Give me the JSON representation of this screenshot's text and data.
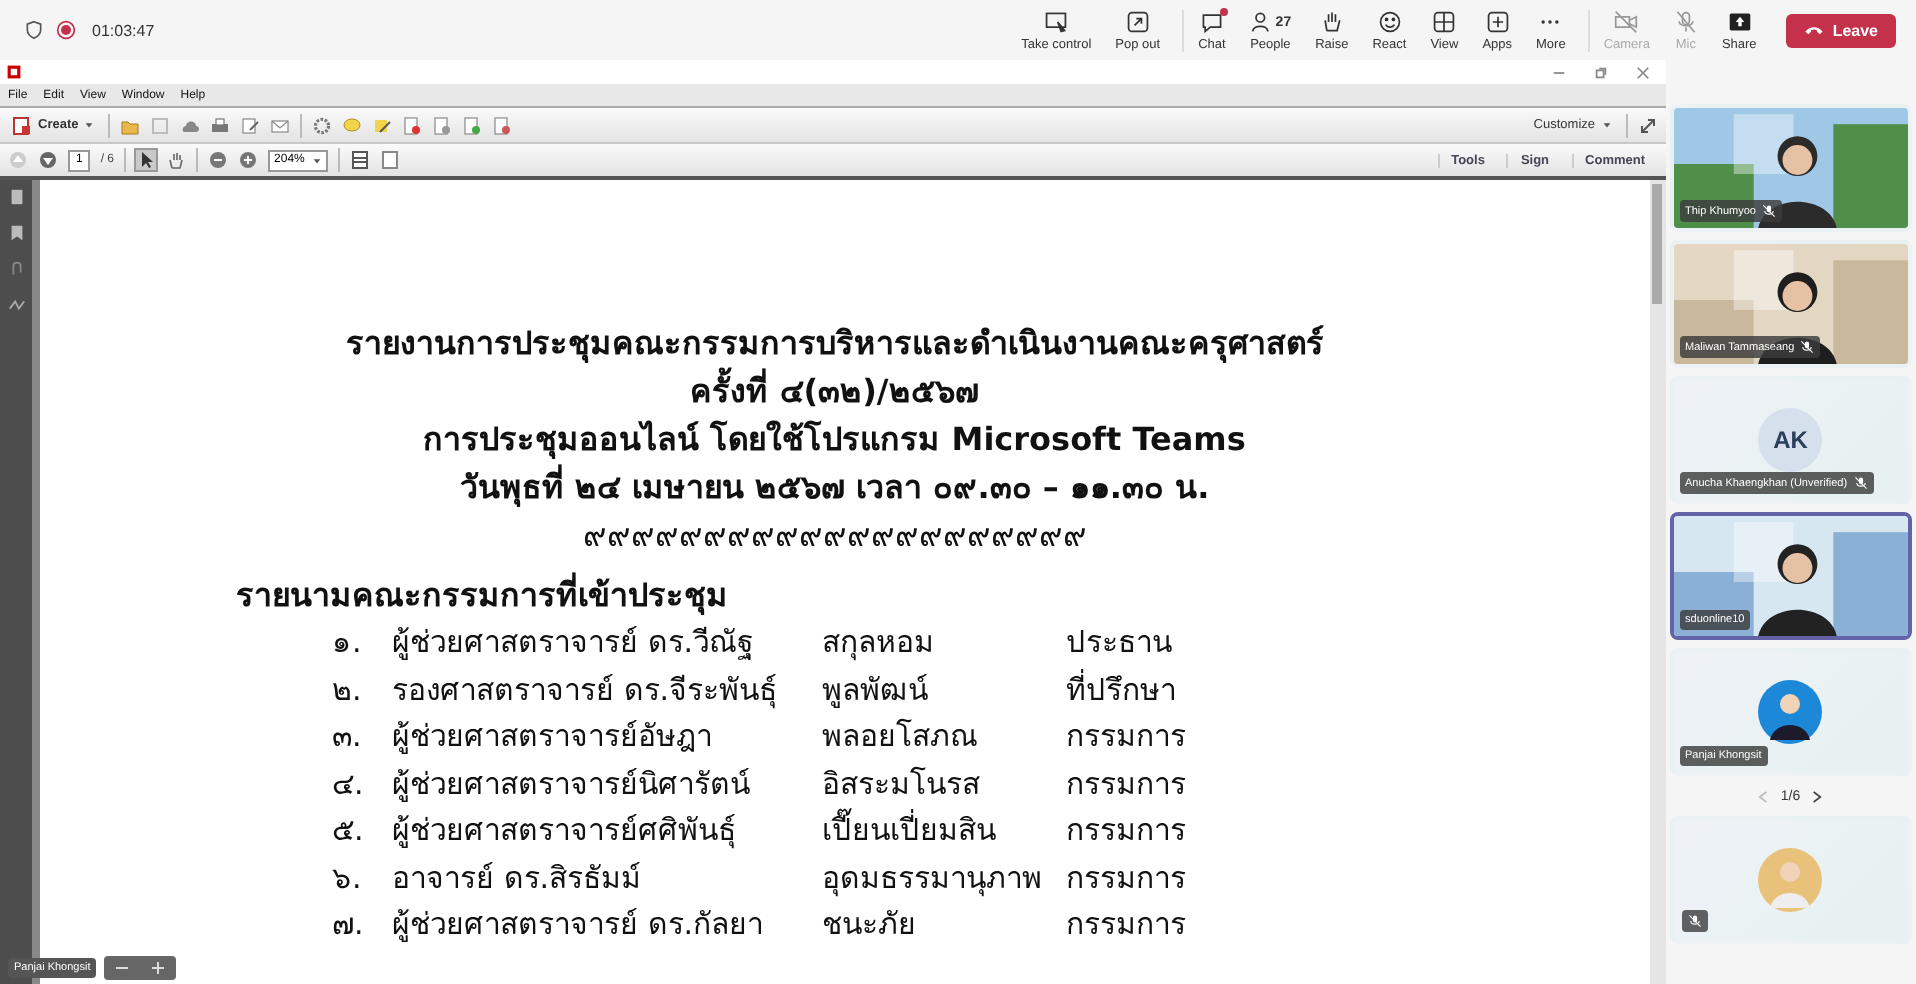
{
  "meeting": {
    "timer": "01:03:47",
    "recording": true
  },
  "toolbar": [
    {
      "label": "Take control",
      "disabled": false
    },
    {
      "label": "Pop out",
      "disabled": false
    },
    {
      "label": "Chat",
      "disabled": false,
      "notification": true
    },
    {
      "label": "People",
      "badge": "27",
      "disabled": false
    },
    {
      "label": "Raise",
      "disabled": false
    },
    {
      "label": "React",
      "disabled": false
    },
    {
      "label": "View",
      "disabled": false
    },
    {
      "label": "Apps",
      "disabled": false
    },
    {
      "label": "More",
      "disabled": false
    },
    {
      "label": "Camera",
      "disabled": true
    },
    {
      "label": "Mic",
      "disabled": true
    },
    {
      "label": "Share",
      "disabled": false
    }
  ],
  "leave_button": "Leave",
  "acrobat": {
    "menu": [
      "File",
      "Edit",
      "View",
      "Window",
      "Help"
    ],
    "create_button": "Create",
    "customize_button": "Customize",
    "page_number": "1",
    "page_total": "/ 6",
    "zoom": "204%",
    "panes": [
      "Tools",
      "Sign",
      "Comment"
    ]
  },
  "document": {
    "title_lines": [
      "รายงานการประชุมคณะกรรมการบริหารและดำเนินงานคณะครุศาสตร์",
      "ครั้งที่ ๔(๓๒)/๒๕๖๗",
      "การประชุมออนไลน์ โดยใช้โปรแกรม Microsoft Teams",
      "วันพุธที่ ๒๔ เมษายน ๒๕๖๗ เวลา ๐๙.๓๐ – ๑๑.๓๐ น."
    ],
    "ornament": "๙๙๙๙๙๙๙๙๙๙๙๙๙๙๙๙๙๙๙๙๙",
    "heading": "รายนามคณะกรรมการที่เข้าประชุม",
    "members": [
      {
        "number": "๑.",
        "name": "ผู้ช่วยศาสตราจารย์ ดร.วีณัฐ",
        "surname": "สกุลหอม",
        "role": "ประธาน"
      },
      {
        "number": "๒.",
        "name": "รองศาสตราจารย์ ดร.จีระพันธุ์",
        "surname": "พูลพัฒน์",
        "role": "ที่ปรึกษา"
      },
      {
        "number": "๓.",
        "name": "ผู้ช่วยศาสตราจารย์อัษฎา",
        "surname": "พลอยโสภณ",
        "role": "กรรมการ"
      },
      {
        "number": "๔.",
        "name": "ผู้ช่วยศาสตราจารย์นิศารัตน์",
        "surname": "อิสระมโนรส",
        "role": "กรรมการ"
      },
      {
        "number": "๕.",
        "name": "ผู้ช่วยศาสตราจารย์ศศิพันธุ์",
        "surname": "เปี๊ยนเปี่ยมสิน",
        "role": "กรรมการ"
      },
      {
        "number": "๖.",
        "name": "อาจารย์ ดร.สิรธัมม์",
        "surname": "อุดมธรรมานุภาพ",
        "role": "กรรมการ"
      },
      {
        "number": "๗.",
        "name": "ผู้ช่วยศาสตราจารย์ ดร.กัลยา",
        "surname": "ชนะภัย",
        "role": "กรรมการ"
      }
    ]
  },
  "presenter_label": "Panjai Khongsit",
  "participants": [
    {
      "kind": "video",
      "name": "Thip Khumyoo",
      "muted": true,
      "selected": false
    },
    {
      "kind": "video",
      "name": "Maliwan Tammaseang",
      "muted": true,
      "selected": false
    },
    {
      "kind": "initials",
      "initials": "AK",
      "name": "Anucha Khaengkhan (Unverified)",
      "muted": true,
      "selected": false
    },
    {
      "kind": "video",
      "name": "sduonline10",
      "muted": false,
      "selected": true
    },
    {
      "kind": "avatar",
      "name": "Panjai Khongsit",
      "muted": false,
      "selected": false
    }
  ],
  "pager": "1/6",
  "more_participants": [
    {
      "kind": "avatar",
      "muted": true,
      "selected": false
    }
  ]
}
